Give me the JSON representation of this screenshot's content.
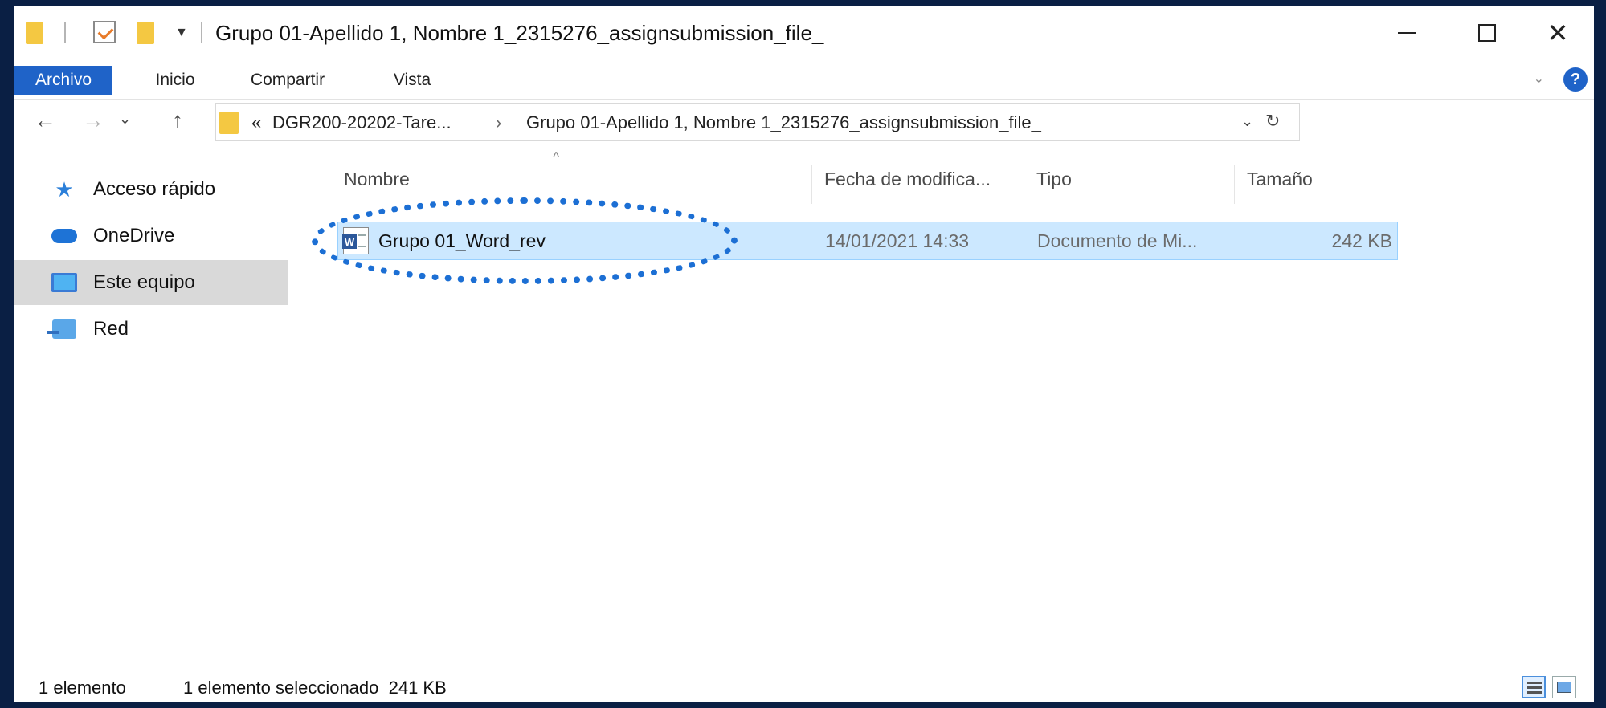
{
  "window": {
    "title": "Grupo 01-Apellido 1, Nombre 1_2315276_assignsubmission_file_",
    "controls": {
      "minimize": "—",
      "maximize": "☐",
      "close": "✕"
    }
  },
  "ribbon": {
    "tabs": [
      {
        "label": "Archivo",
        "active": true
      },
      {
        "label": "Inicio",
        "active": false
      },
      {
        "label": "Compartir",
        "active": false
      },
      {
        "label": "Vista",
        "active": false
      }
    ],
    "help": "?"
  },
  "address": {
    "overflow": "«",
    "segments": [
      "DGR200-20202-Tare...",
      "Grupo 01-Apellido 1, Nombre 1_2315276_assignsubmission_file_"
    ],
    "separator": "›"
  },
  "sidebar": {
    "items": [
      {
        "label": "Acceso rápido",
        "icon": "star-icon"
      },
      {
        "label": "OneDrive",
        "icon": "cloud-icon"
      },
      {
        "label": "Este equipo",
        "icon": "computer-icon",
        "selected": true
      },
      {
        "label": "Red",
        "icon": "network-icon"
      }
    ]
  },
  "filelist": {
    "columns": [
      "Nombre",
      "Fecha de modifica...",
      "Tipo",
      "Tamaño"
    ],
    "rows": [
      {
        "name": "Grupo 01_Word_rev",
        "date": "14/01/2021 14:33",
        "type": "Documento de Mi...",
        "size": "242 KB"
      }
    ]
  },
  "status": {
    "count": "1 elemento",
    "selection": "1 elemento seleccionado  241 KB"
  },
  "colors": {
    "accent": "#1f63c8",
    "selection": "#cce8ff",
    "highlight": "#1c6fd4",
    "frame": "#0a1f44"
  }
}
